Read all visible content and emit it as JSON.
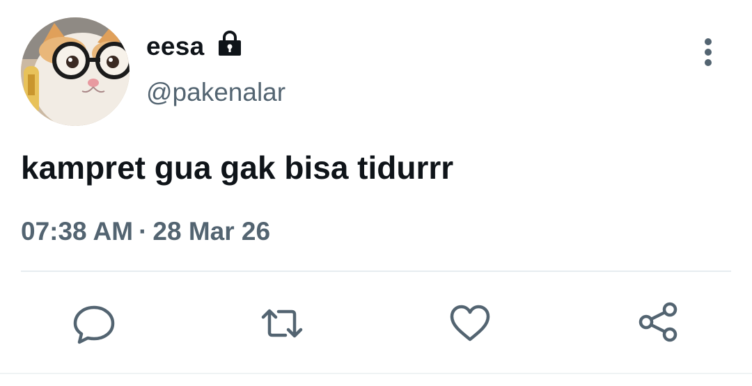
{
  "tweet": {
    "author": {
      "display_name": "eesa",
      "handle": "@pakenalar",
      "protected_icon": "lock-icon",
      "avatar": "cat-with-glasses-avatar"
    },
    "text": "kampret gua gak bisa tidurrr",
    "time": "07:38 AM",
    "separator": "·",
    "date": "28 Mar 26",
    "more_icon": "more-vertical-icon"
  },
  "actions": [
    {
      "name": "reply",
      "icon": "comment-icon"
    },
    {
      "name": "retweet",
      "icon": "retweet-icon"
    },
    {
      "name": "like",
      "icon": "heart-icon"
    },
    {
      "name": "share",
      "icon": "share-icon"
    }
  ],
  "colors": {
    "text_primary": "#0f1419",
    "text_secondary": "#536471",
    "divider": "#e6ecf0"
  }
}
